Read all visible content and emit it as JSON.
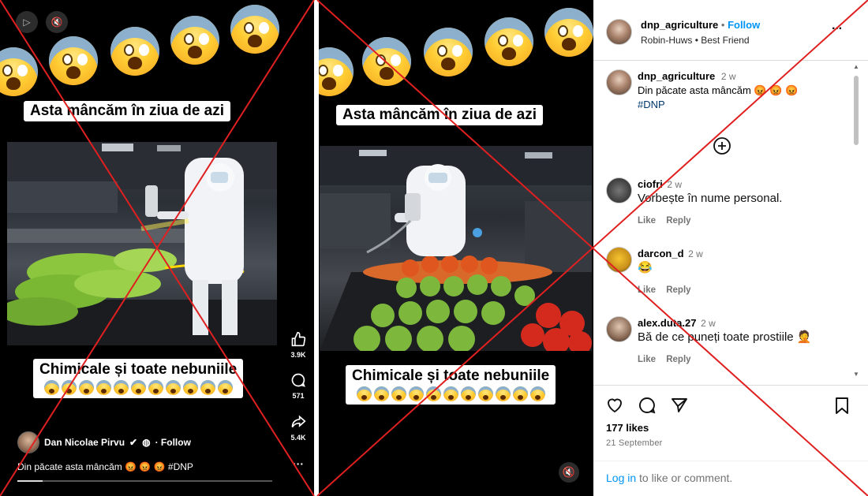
{
  "reel": {
    "caption_top": "Asta mâncăm în ziua de azi",
    "caption_bottom": "Chimicale și toate nebuniile",
    "likes": "3.9K",
    "comments": "571",
    "shares": "5.4K",
    "more": "···",
    "author": "Dan Nicolae Pirvu",
    "follow_text": "· Follow",
    "caption": "Din păcate asta mâncăm 😡 😡 😡 #DNP",
    "progress": 0.1,
    "play_icon": "play-icon",
    "mute_icon": "mute-icon"
  },
  "media": {
    "caption_top": "Asta mâncăm în ziua de azi",
    "caption_bottom": "Chimicale și toate nebuniile",
    "mute_icon": "mute-icon"
  },
  "post": {
    "username": "dnp_agriculture",
    "follow": "Follow",
    "separator": "•",
    "subtitle": "Robin-Huws • Best Friend",
    "more": "···",
    "author_comment": {
      "username": "dnp_agriculture",
      "time": "2 w",
      "text": "Din păcate asta mâncăm 😡 😡 😡",
      "hashtag": "#DNP"
    },
    "load_more_icon": "plus-circle-icon",
    "comments": [
      {
        "username": "ciofri",
        "time": "2 w",
        "text": "Vorbește în nume personal.",
        "like": "Like",
        "reply": "Reply"
      },
      {
        "username": "darcon_d",
        "time": "2 w",
        "text": "😂",
        "like": "Like",
        "reply": "Reply"
      },
      {
        "username": "alex.duta.27",
        "time": "2 w",
        "text": "Bă de ce puneți toate prostiile 🤦",
        "like": "Like",
        "reply": "Reply"
      }
    ],
    "likes": "177 likes",
    "date": "21 September",
    "login_link": "Log in",
    "login_rest": " to like or comment."
  },
  "colors": {
    "cross": "#e02020",
    "link_blue": "#0095f6",
    "hashtag_blue": "#00376b"
  }
}
